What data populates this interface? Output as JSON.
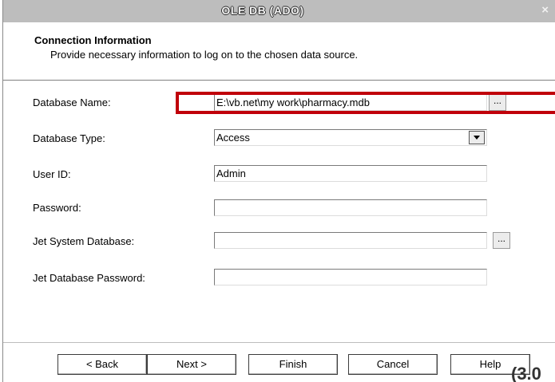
{
  "window": {
    "title": "OLE DB (ADO)",
    "close_glyph": "×"
  },
  "header": {
    "title": "Connection Information",
    "subtitle": "Provide necessary information to log on to the chosen data source."
  },
  "form": {
    "database_name": {
      "label": "Database Name:",
      "value": "E:\\vb.net\\my work\\pharmacy.mdb",
      "browse": "..."
    },
    "database_type": {
      "label": "Database Type:",
      "value": "Access"
    },
    "user_id": {
      "label": "User ID:",
      "value": "Admin"
    },
    "password": {
      "label": "Password:",
      "value": ""
    },
    "jet_system_database": {
      "label": "Jet System Database:",
      "value": "",
      "browse": "..."
    },
    "jet_database_password": {
      "label": "Jet Database Password:",
      "value": ""
    }
  },
  "buttons": {
    "back": "< Back",
    "next": "Next >",
    "finish": "Finish",
    "cancel": "Cancel",
    "help": "Help"
  },
  "corner_text": "(3.0",
  "annotation": {
    "highlight_color": "#c0000a"
  }
}
